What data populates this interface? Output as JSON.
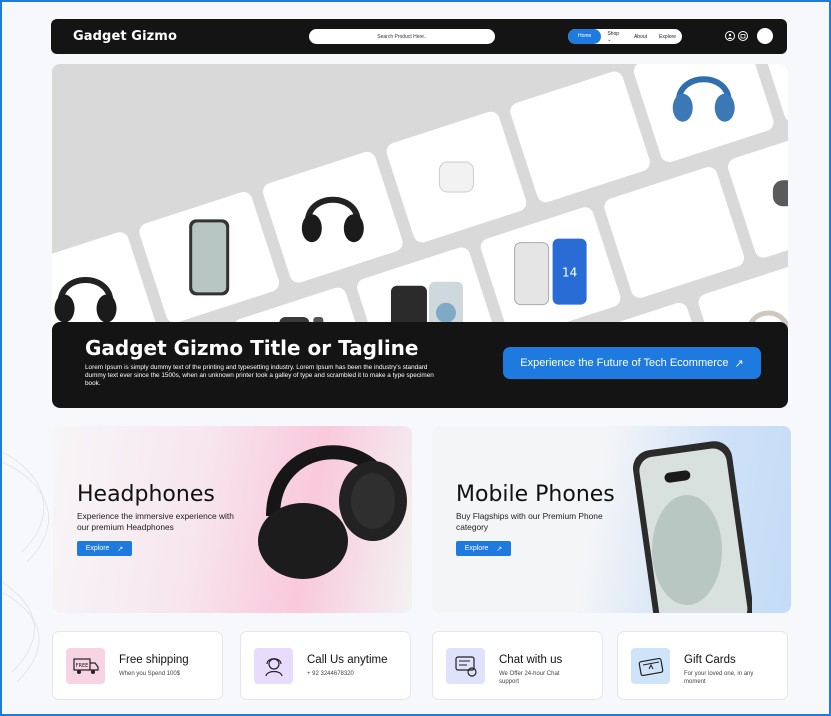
{
  "brand": "Gadget Gizmo",
  "search": {
    "placeholder": "Search Product Here.."
  },
  "menu": {
    "home": "Home",
    "shop": "Shop",
    "about": "About",
    "explore": "Explore"
  },
  "hero": {
    "title": "Gadget Gizmo Title or Tagline",
    "text": "Lorem Ipsum is simply dummy text of the printing and typesetting industry. Lorem Ipsum has been the industry's standard dummy text ever since the 1500s, when an unknown printer took a galley of type and scrambled it to make a type specimen book.",
    "cta": "Experience the Future of Tech Ecommerce",
    "cta_icon": "arrow-up-right-icon"
  },
  "categories": [
    {
      "title": "Headphones",
      "subtitle": "Experience the immersive experience with our premium Headphones",
      "button": "Explore"
    },
    {
      "title": "Mobile Phones",
      "subtitle": "Buy Flagships with our Premium Phone category",
      "button": "Explore"
    }
  ],
  "features": [
    {
      "title": "Free shipping",
      "subtitle": "When you Spend 100$",
      "icon": "truck-icon",
      "color": "#f8d3e3"
    },
    {
      "title": "Call Us anytime",
      "subtitle": "+ 92 3244678320",
      "icon": "headset-icon",
      "color": "#e7dcfb"
    },
    {
      "title": "Chat with us",
      "subtitle": "We Offer 24-hour Chat support",
      "icon": "chat-icon",
      "color": "#dfe2fb"
    },
    {
      "title": "Gift Cards",
      "subtitle": "For your loved one, in any moment",
      "icon": "gift-card-icon",
      "color": "#cfe3f9"
    }
  ],
  "colors": {
    "accent": "#1f7ae0",
    "dark": "#141414"
  }
}
